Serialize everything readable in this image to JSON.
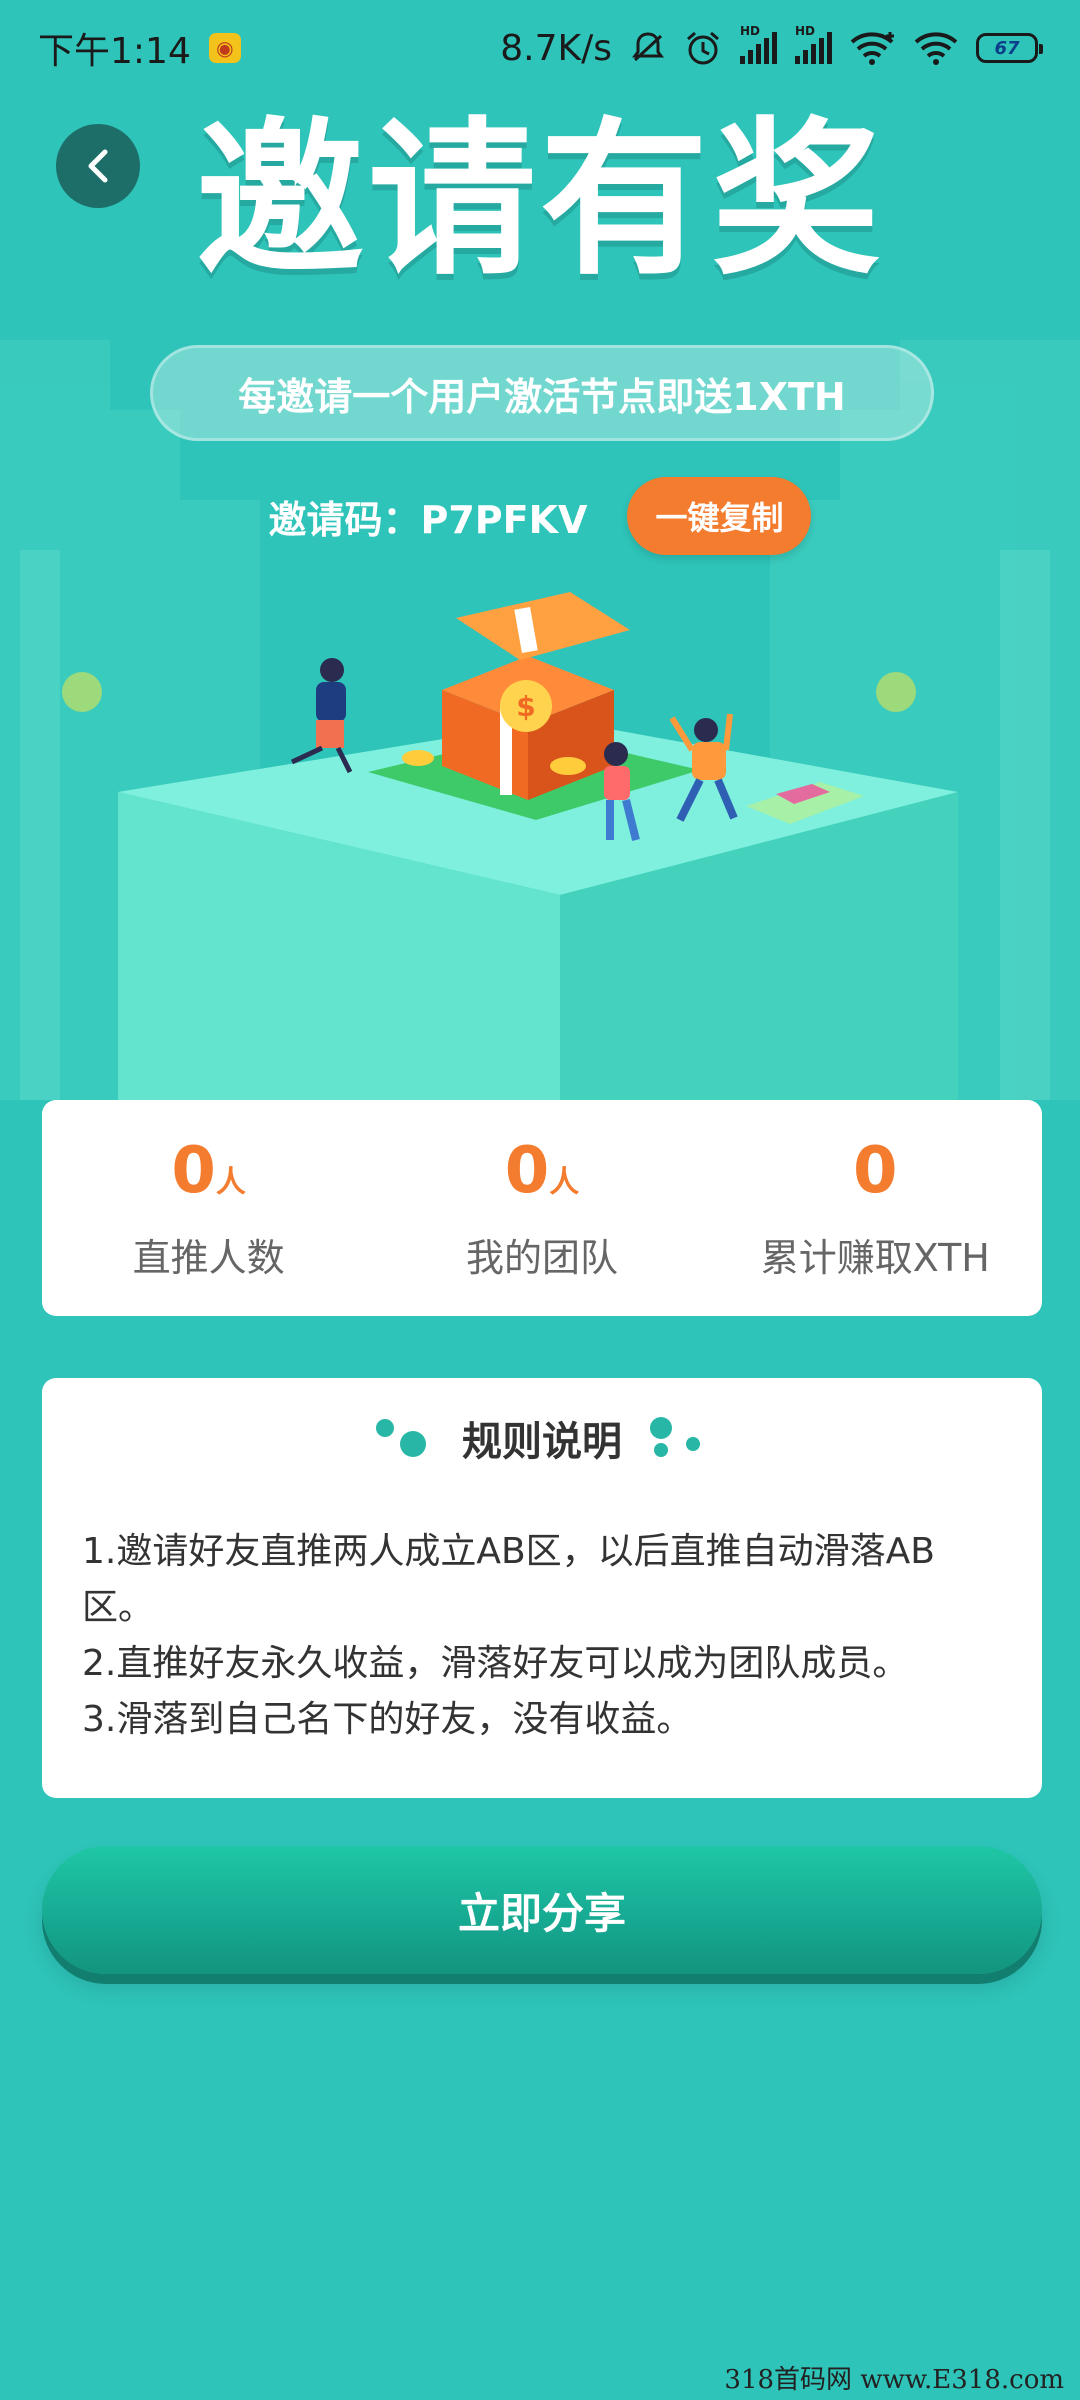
{
  "status_bar": {
    "time": "下午1:14",
    "network_speed": "8.7K/s",
    "battery": "67",
    "sig_label": "HD"
  },
  "header": {
    "title": "邀请有奖",
    "subtitle": "每邀请一个用户激活节点即送1XTH",
    "invite_code_text": "邀请码：P7PFKV",
    "copy_button": "一键复制"
  },
  "stats": [
    {
      "value": "0",
      "unit": "人",
      "label": "直推人数"
    },
    {
      "value": "0",
      "unit": "人",
      "label": "我的团队"
    },
    {
      "value": "0",
      "unit": "",
      "label": "累计赚取XTH"
    }
  ],
  "rules": {
    "title": "规则说明",
    "lines": [
      "1.邀请好友直推两人成立AB区，以后直推自动滑落AB区。",
      "2.直推好友永久收益，滑落好友可以成为团队成员。",
      "3.滑落到自己名下的好友，没有收益。"
    ]
  },
  "share_button": "立即分享",
  "watermark": "318首码网 www.E318.com",
  "colors": {
    "background": "#2ec4b9",
    "accent_orange": "#f47c2f",
    "share_green": "#16a891"
  }
}
